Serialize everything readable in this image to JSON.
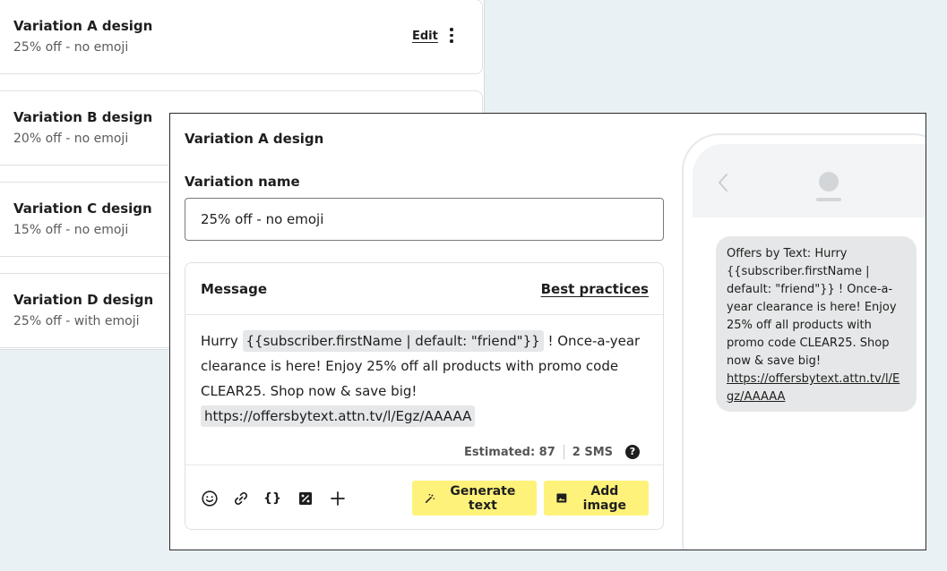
{
  "variations": [
    {
      "title": "Variation A design",
      "subtitle": "25% off - no emoji",
      "edit_label": "Edit"
    },
    {
      "title": "Variation B design",
      "subtitle": "20% off - no emoji"
    },
    {
      "title": "Variation C design",
      "subtitle": "15% off - no emoji"
    },
    {
      "title": "Variation D design",
      "subtitle": "25% off - with emoji"
    }
  ],
  "editor": {
    "title": "Variation A design",
    "name_label": "Variation name",
    "name_value": "25% off - no emoji",
    "message": {
      "label": "Message",
      "best_practices": "Best practices",
      "text_before": "Hurry ",
      "token": "{{subscriber.firstName | default: \"friend\"}}",
      "text_after": " ! Once-a-year clearance is here! Enjoy 25% off all products with promo code CLEAR25. Shop now & save big!",
      "link": "https://offersbytext.attn.tv/l/Egz/AAAAA",
      "estimated": "Estimated: 87",
      "sms_count": "2 SMS",
      "help": "?"
    },
    "toolbar": {
      "emoji": "emoji-icon",
      "link": "link-icon",
      "variable": "{}",
      "discount": "discount-icon",
      "add": "plus-icon",
      "generate_label": "Generate text",
      "add_image_label": "Add image"
    }
  },
  "preview": {
    "bubble_text": "Offers by Text: Hurry {{subscriber.firstName | default: \"friend\"}} ! Once-a-year clearance is here! Enjoy 25% off all products with promo code CLEAR25. Shop now & save big!",
    "bubble_link": "https://offersbytext.attn.tv/l/Egz/AAAAA"
  },
  "colors": {
    "background": "#e9f1f4",
    "button_yellow": "#fff27a",
    "token_bg": "#e5e7e8"
  }
}
